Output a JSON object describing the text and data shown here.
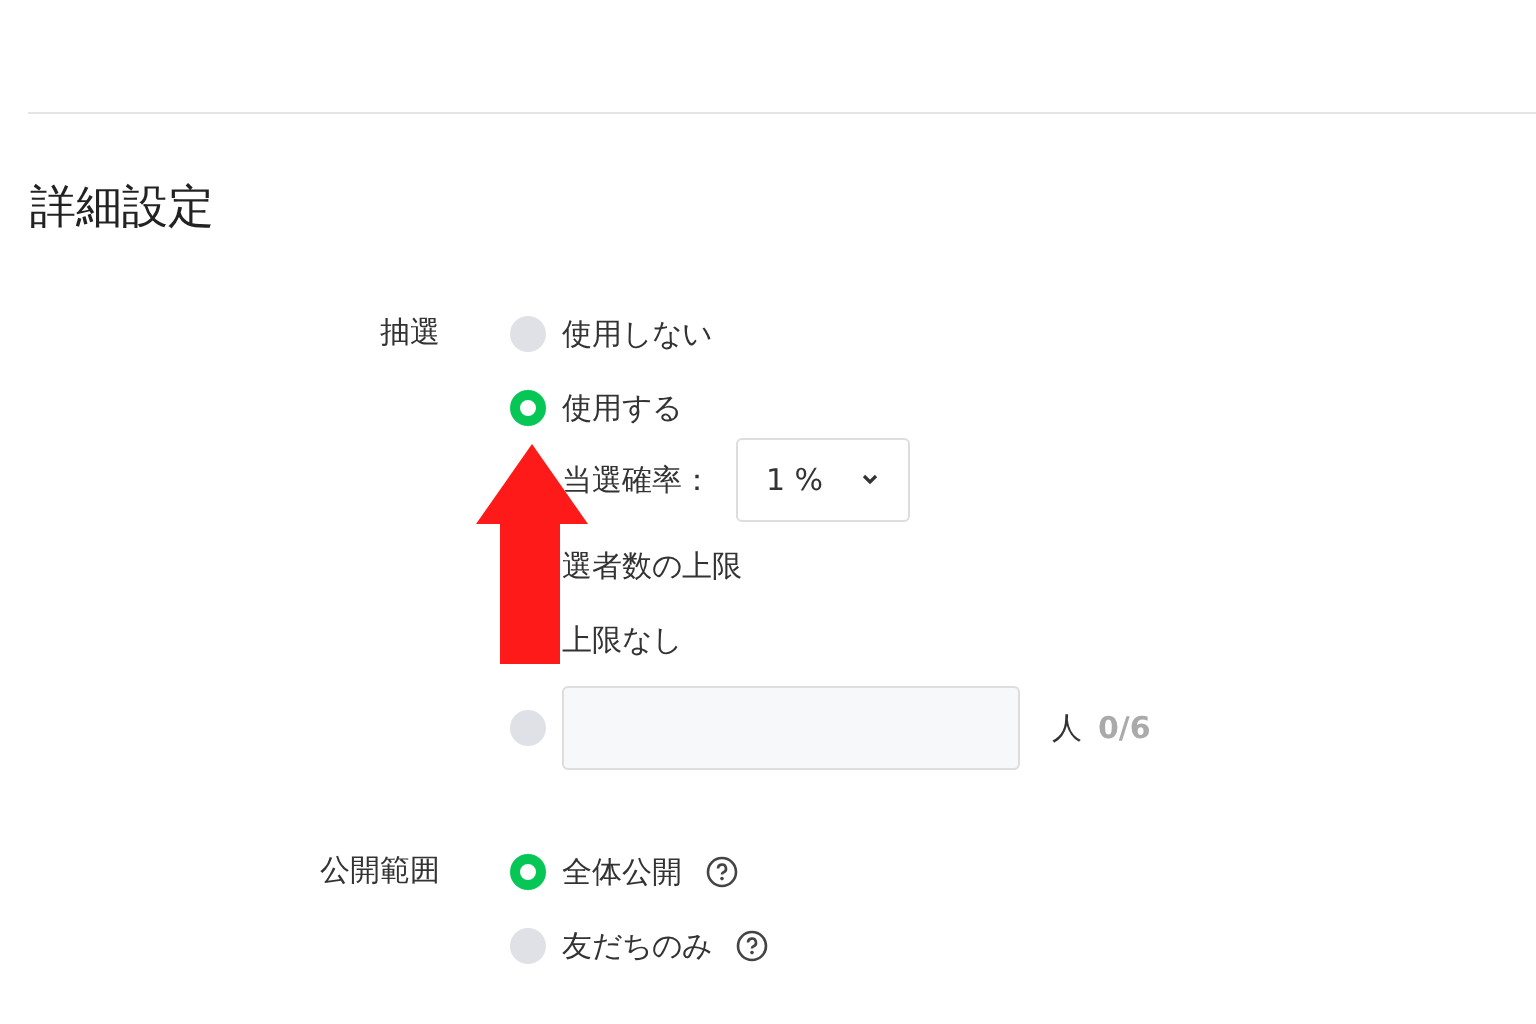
{
  "section_title": "詳細設定",
  "lottery": {
    "label": "抽選",
    "options": [
      {
        "label": "使用しない",
        "selected": false
      },
      {
        "label": "使用する",
        "selected": true
      }
    ],
    "probability": {
      "label": "当選確率：",
      "value": "1 %"
    },
    "limit_heading": "選者数の上限",
    "limit_options": [
      {
        "kind": "text",
        "label": "上限なし"
      },
      {
        "kind": "input",
        "selected": false,
        "unit": "人",
        "count": "0/6"
      }
    ]
  },
  "visibility": {
    "label": "公開範囲",
    "options": [
      {
        "label": "全体公開",
        "selected": true
      },
      {
        "label": "友だちのみ",
        "selected": false
      }
    ]
  }
}
